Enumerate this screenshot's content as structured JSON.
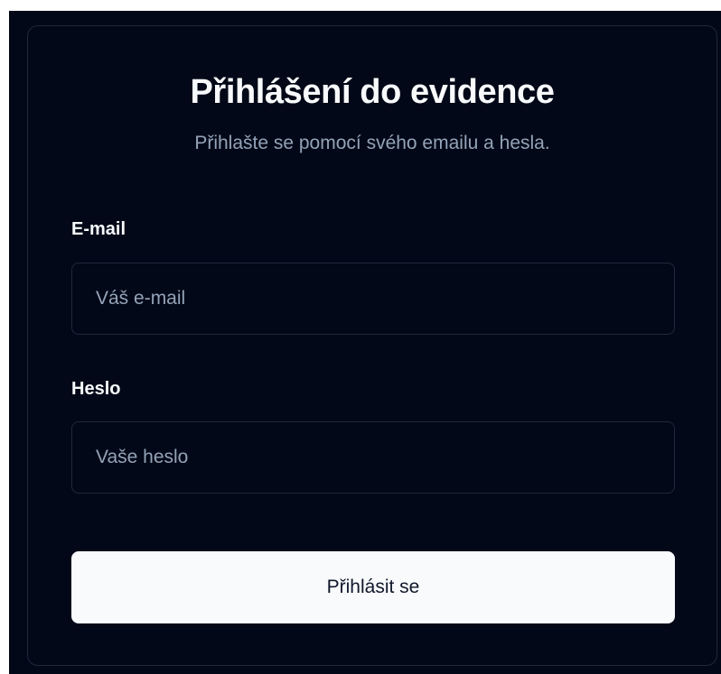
{
  "login": {
    "title": "Přihlášení do evidence",
    "subtitle": "Přihlašte se pomocí svého emailu a hesla.",
    "email": {
      "label": "E-mail",
      "value": "",
      "placeholder": "Váš e-mail"
    },
    "password": {
      "label": "Heslo",
      "value": "",
      "placeholder": "Vaše heslo"
    },
    "submit_label": "Přihlásit se"
  },
  "colors": {
    "background": "#020817",
    "border": "#1e293b",
    "text_primary": "#f8fafc",
    "text_muted": "#94a3b8",
    "button_background": "#f8fafc",
    "button_text": "#0f172a"
  }
}
